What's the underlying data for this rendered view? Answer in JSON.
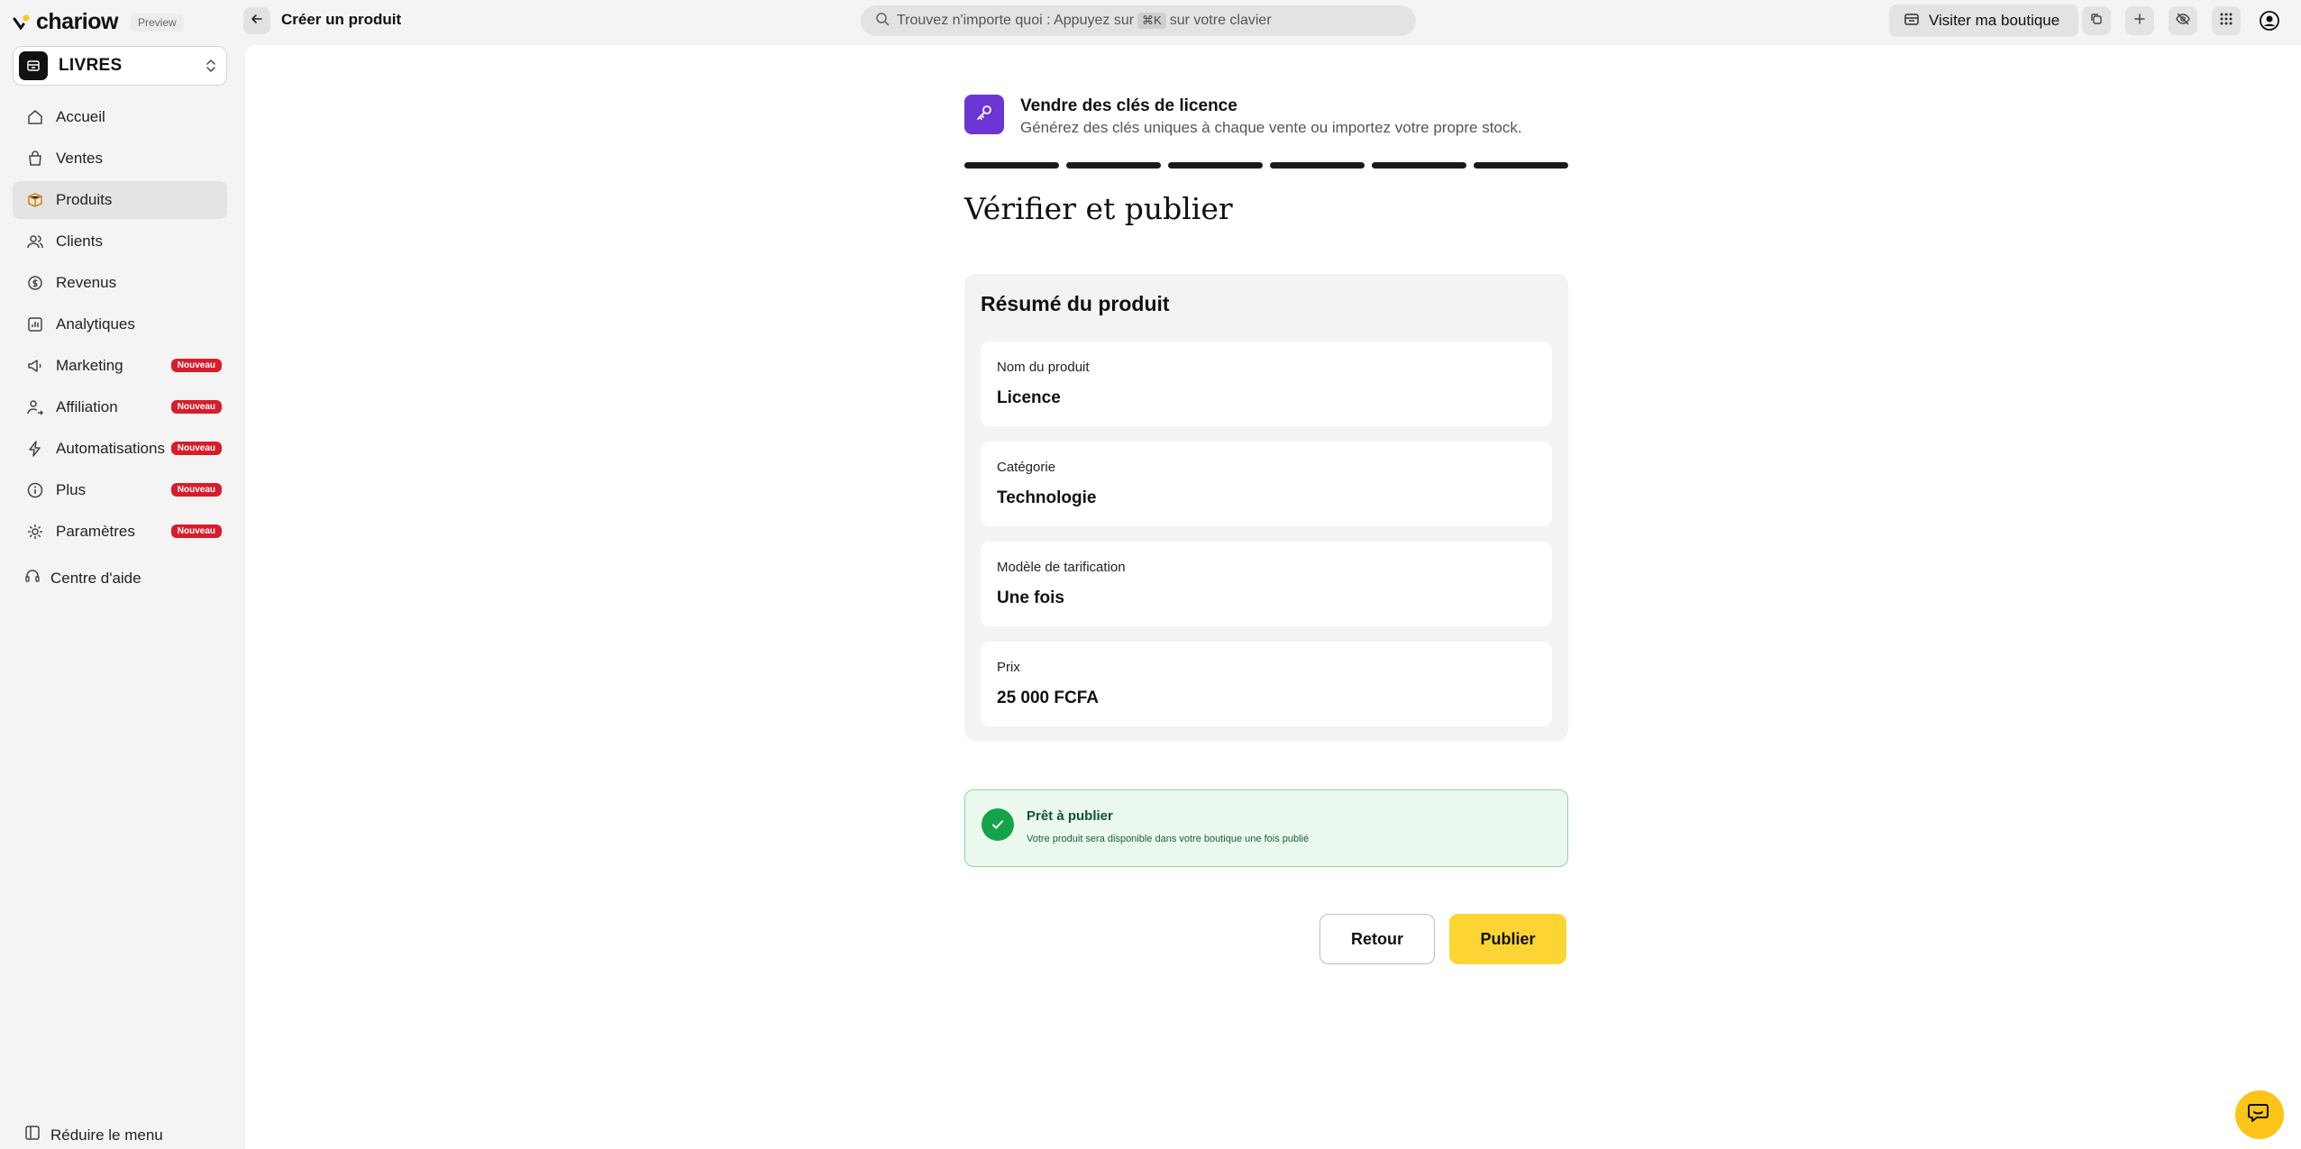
{
  "brand": {
    "name": "chariow",
    "badge": "Preview"
  },
  "header": {
    "page_title": "Créer un produit",
    "search_prefix": "Trouvez n'importe quoi : Appuyez sur",
    "search_shortcut": "⌘K",
    "search_suffix": "sur votre clavier",
    "visit_label": "Visiter ma boutique"
  },
  "sidebar": {
    "store_name": "LIVRES",
    "items": [
      {
        "label": "Accueil",
        "icon": "home-icon"
      },
      {
        "label": "Ventes",
        "icon": "bag-icon"
      },
      {
        "label": "Produits",
        "icon": "box-icon",
        "active": true
      },
      {
        "label": "Clients",
        "icon": "users-icon"
      },
      {
        "label": "Revenus",
        "icon": "money-icon"
      },
      {
        "label": "Analytiques",
        "icon": "chart-icon"
      },
      {
        "label": "Marketing",
        "icon": "megaphone-icon",
        "badge": "Nouveau"
      },
      {
        "label": "Affiliation",
        "icon": "affiliate-icon",
        "badge": "Nouveau"
      },
      {
        "label": "Automatisations",
        "icon": "bolt-icon",
        "badge": "Nouveau"
      },
      {
        "label": "Plus",
        "icon": "info-icon",
        "badge": "Nouveau"
      },
      {
        "label": "Paramètres",
        "icon": "gear-icon",
        "badge": "Nouveau"
      }
    ],
    "help_label": "Centre d'aide",
    "collapse_label": "Réduire le menu"
  },
  "flow": {
    "title": "Vendre des clés de licence",
    "subtitle": "Générez des clés uniques à chaque vente ou importez votre propre stock.",
    "steps_total": 6,
    "steps_completed": 6
  },
  "main": {
    "title": "Vérifier et publier",
    "summary": {
      "title": "Résumé du produit",
      "fields": [
        {
          "label": "Nom du produit",
          "value": "Licence"
        },
        {
          "label": "Catégorie",
          "value": "Technologie"
        },
        {
          "label": "Modèle de tarification",
          "value": "Une fois"
        },
        {
          "label": "Prix",
          "value": "25 000 FCFA"
        }
      ]
    },
    "ready": {
      "title": "Prêt à publier",
      "subtitle": "Votre produit sera disponible dans votre boutique une fois publié"
    },
    "back_label": "Retour",
    "publish_label": "Publier"
  },
  "colors": {
    "accent": "#fcd535",
    "flow_icon_bg": "#6d35d4",
    "success": "#15a34a",
    "badge_red": "#d71d2c"
  }
}
